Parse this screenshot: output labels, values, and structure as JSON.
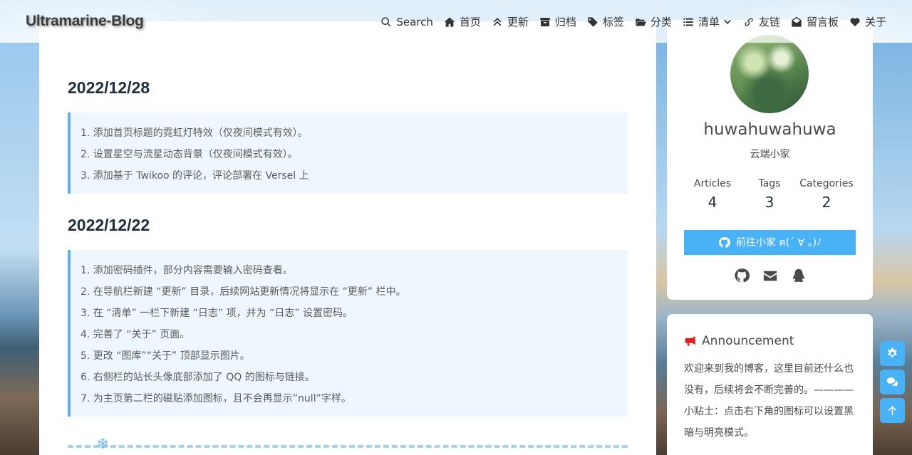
{
  "brand": {
    "title": "Ultramarine-Blog"
  },
  "nav": {
    "items": [
      {
        "label": "Search",
        "icon": "search-icon"
      },
      {
        "label": "首页",
        "icon": "home-icon"
      },
      {
        "label": "更新",
        "icon": "angles-up-icon"
      },
      {
        "label": "归档",
        "icon": "archive-icon"
      },
      {
        "label": "标签",
        "icon": "tags-icon"
      },
      {
        "label": "分类",
        "icon": "folder-open-icon"
      },
      {
        "label": "清单",
        "icon": "list-icon"
      },
      {
        "label": "友链",
        "icon": "link-icon"
      },
      {
        "label": "留言板",
        "icon": "envelope-open-icon"
      },
      {
        "label": "关于",
        "icon": "heart-icon"
      }
    ]
  },
  "updates": [
    {
      "date": "2022/12/28",
      "items": [
        "1. 添加首页标题的霓虹灯特效（仅夜间模式有效）。",
        "2. 设置星空与流星动态背景（仅夜间模式有效）。",
        "3. 添加基于 Twikoo 的评论，评论部署在 Versel 上"
      ]
    },
    {
      "date": "2022/12/22",
      "items": [
        "1. 添加密码插件，部分内容需要输入密码查看。",
        "2. 在导航栏新建 “更新” 目录，后续网站更新情况将显示在 “更新” 栏中。",
        "3. 在 “清单” 一栏下新建 “日志” 项，并为 “日志” 设置密码。",
        "4. 完善了 “关于” 页面。",
        "5. 更改 “图库”“关于” 顶部显示图片。",
        "6. 右侧栏的站长头像底部添加了 QQ 的图标与链接。",
        "7. 为主页第二栏的磁贴添加图标，且不会再显示”null”字样。"
      ]
    }
  ],
  "divider_glyph": "❄",
  "profile": {
    "name": "huwahuwahuwa",
    "description": "云端小家",
    "stats": [
      {
        "label": "Articles",
        "value": "4"
      },
      {
        "label": "Tags",
        "value": "3"
      },
      {
        "label": "Categories",
        "value": "2"
      }
    ],
    "button_label": "前往小家 ฅ(ˊ ∀ 。)ﾉ",
    "social": [
      "github-icon",
      "email-icon",
      "qq-icon"
    ]
  },
  "announcement": {
    "title": "Announcement",
    "text": "欢迎来到我的博客，这里目前还什么也没有，后续将会不断完善的。———— 小贴士：点击右下角的图标可以设置黑暗与明亮模式。"
  },
  "floating_buttons": [
    "gear-icon",
    "comments-icon",
    "arrow-up-icon"
  ],
  "colors": {
    "accent": "#49b1f5",
    "note_bg": "#eef7fd",
    "note_border": "#5eb1e6"
  }
}
